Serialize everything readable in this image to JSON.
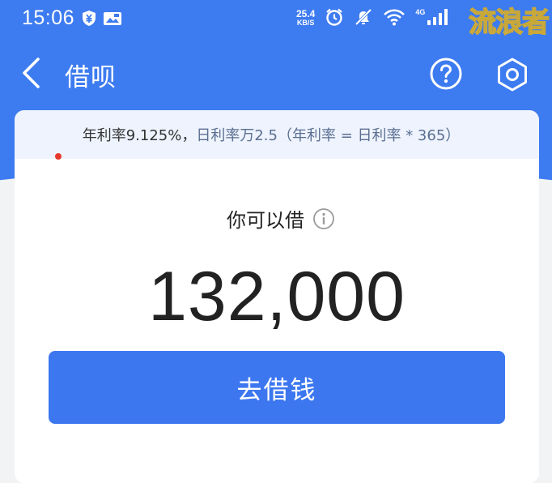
{
  "status_bar": {
    "time": "15:06",
    "net_speed_value": "25.4",
    "net_speed_unit": "KB/S",
    "signal_label": "4G",
    "watermark": "流浪者"
  },
  "nav": {
    "title": "借呗",
    "icons": [
      "back-arrow-icon",
      "help-icon",
      "settings-icon"
    ]
  },
  "rate_banner": {
    "annual": "年利率9.125%，",
    "daily": "日利率万2.5（年利率 = 日利率 * 365）"
  },
  "borrow": {
    "label": "你可以借",
    "amount": "132,000",
    "button_label": "去借钱"
  },
  "colors": {
    "brand_blue": "#3d7bf0",
    "button_blue": "#3c77f0",
    "banner_bg": "#eef3fd",
    "page_bg": "#f2f3f5"
  }
}
